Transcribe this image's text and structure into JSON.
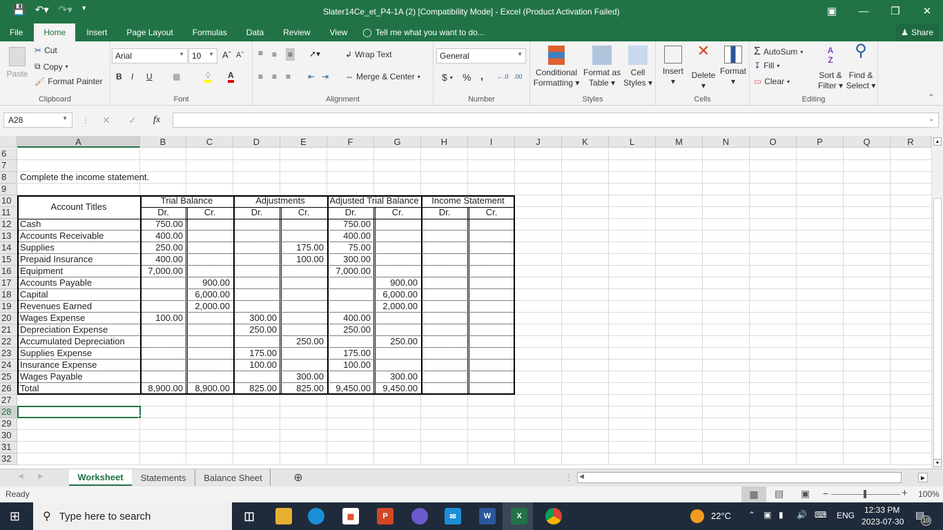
{
  "window": {
    "title": "Slater14Ce_et_P4-1A (2)  [Compatibility Mode] - Excel (Product Activation Failed)",
    "controls": [
      "ribbon-display",
      "minimize",
      "restore",
      "close"
    ]
  },
  "ribbon_tabs": [
    "File",
    "Home",
    "Insert",
    "Page Layout",
    "Formulas",
    "Data",
    "Review",
    "View"
  ],
  "active_tab": "Home",
  "tell_me": "Tell me what you want to do...",
  "share_label": "Share",
  "ribbon": {
    "clipboard": {
      "label": "Clipboard",
      "paste": "Paste",
      "cut": "Cut",
      "copy": "Copy",
      "format_painter": "Format Painter"
    },
    "font": {
      "label": "Font",
      "font_name": "Arial",
      "font_size": "10",
      "bold": "B",
      "italic": "I",
      "underline": "U",
      "fill_color": "#ffff00",
      "font_color": "#e00000"
    },
    "alignment": {
      "label": "Alignment",
      "wrap_text": "Wrap Text",
      "merge_center": "Merge & Center"
    },
    "number": {
      "label": "Number",
      "format": "General",
      "currency": "$",
      "percent": "%",
      "comma": ","
    },
    "styles": {
      "label": "Styles",
      "conditional_1": "Conditional",
      "conditional_2": "Formatting",
      "format_table_1": "Format as",
      "format_table_2": "Table",
      "cell_styles_1": "Cell",
      "cell_styles_2": "Styles"
    },
    "cells": {
      "label": "Cells",
      "insert": "Insert",
      "delete": "Delete",
      "format": "Format"
    },
    "editing": {
      "label": "Editing",
      "autosum": "AutoSum",
      "fill": "Fill",
      "clear": "Clear",
      "sort_1": "Sort &",
      "sort_2": "Filter",
      "find_1": "Find &",
      "find_2": "Select"
    }
  },
  "formula_bar": {
    "name_box": "A28",
    "fx": "fx",
    "value": ""
  },
  "columns": [
    "A",
    "B",
    "C",
    "D",
    "E",
    "F",
    "G",
    "H",
    "I",
    "J",
    "K",
    "L",
    "M",
    "N",
    "O",
    "P",
    "Q",
    "R"
  ],
  "rows": [
    "6",
    "7",
    "8",
    "9",
    "10",
    "11",
    "12",
    "13",
    "14",
    "15",
    "16",
    "17",
    "18",
    "19",
    "20",
    "21",
    "22",
    "23",
    "24",
    "25",
    "26",
    "27",
    "28",
    "29",
    "30",
    "31",
    "32"
  ],
  "instruction": "Complete the income statement.",
  "worksheet": {
    "account_titles_header": "Account Titles",
    "groups": [
      "Trial Balance",
      "Adjustments",
      "Adjusted Trial Balance",
      "Income Statement"
    ],
    "sub": [
      "Dr.",
      "Cr.",
      "Dr.",
      "Cr.",
      "Dr.",
      "Cr.",
      "Dr.",
      "Cr."
    ],
    "rows": [
      {
        "row": "12",
        "account": "Cash",
        "tb_dr": "750.00",
        "tb_cr": "",
        "adj_dr": "",
        "adj_cr": "",
        "atb_dr": "750.00",
        "atb_cr": "",
        "is_dr": "",
        "is_cr": ""
      },
      {
        "row": "13",
        "account": "Accounts Receivable",
        "tb_dr": "400.00",
        "tb_cr": "",
        "adj_dr": "",
        "adj_cr": "",
        "atb_dr": "400.00",
        "atb_cr": "",
        "is_dr": "",
        "is_cr": ""
      },
      {
        "row": "14",
        "account": "Supplies",
        "tb_dr": "250.00",
        "tb_cr": "",
        "adj_dr": "",
        "adj_cr": "175.00",
        "atb_dr": "75.00",
        "atb_cr": "",
        "is_dr": "",
        "is_cr": ""
      },
      {
        "row": "15",
        "account": "Prepaid Insurance",
        "tb_dr": "400.00",
        "tb_cr": "",
        "adj_dr": "",
        "adj_cr": "100.00",
        "atb_dr": "300.00",
        "atb_cr": "",
        "is_dr": "",
        "is_cr": ""
      },
      {
        "row": "16",
        "account": "Equipment",
        "tb_dr": "7,000.00",
        "tb_cr": "",
        "adj_dr": "",
        "adj_cr": "",
        "atb_dr": "7,000.00",
        "atb_cr": "",
        "is_dr": "",
        "is_cr": ""
      },
      {
        "row": "17",
        "account": "Accounts Payable",
        "tb_dr": "",
        "tb_cr": "900.00",
        "adj_dr": "",
        "adj_cr": "",
        "atb_dr": "",
        "atb_cr": "900.00",
        "is_dr": "",
        "is_cr": ""
      },
      {
        "row": "18",
        "account": "Capital",
        "tb_dr": "",
        "tb_cr": "6,000.00",
        "adj_dr": "",
        "adj_cr": "",
        "atb_dr": "",
        "atb_cr": "6,000.00",
        "is_dr": "",
        "is_cr": ""
      },
      {
        "row": "19",
        "account": "Revenues Earned",
        "tb_dr": "",
        "tb_cr": "2,000.00",
        "adj_dr": "",
        "adj_cr": "",
        "atb_dr": "",
        "atb_cr": "2,000.00",
        "is_dr": "",
        "is_cr": ""
      },
      {
        "row": "20",
        "account": "Wages Expense",
        "tb_dr": "100.00",
        "tb_cr": "",
        "adj_dr": "300.00",
        "adj_cr": "",
        "atb_dr": "400.00",
        "atb_cr": "",
        "is_dr": "",
        "is_cr": ""
      },
      {
        "row": "21",
        "account": "Depreciation Expense",
        "tb_dr": "",
        "tb_cr": "",
        "adj_dr": "250.00",
        "adj_cr": "",
        "atb_dr": "250.00",
        "atb_cr": "",
        "is_dr": "",
        "is_cr": ""
      },
      {
        "row": "22",
        "account": "Accumulated Depreciation",
        "tb_dr": "",
        "tb_cr": "",
        "adj_dr": "",
        "adj_cr": "250.00",
        "atb_dr": "",
        "atb_cr": "250.00",
        "is_dr": "",
        "is_cr": ""
      },
      {
        "row": "23",
        "account": "Supplies Expense",
        "tb_dr": "",
        "tb_cr": "",
        "adj_dr": "175.00",
        "adj_cr": "",
        "atb_dr": "175.00",
        "atb_cr": "",
        "is_dr": "",
        "is_cr": ""
      },
      {
        "row": "24",
        "account": "Insurance Expense",
        "tb_dr": "",
        "tb_cr": "",
        "adj_dr": "100.00",
        "adj_cr": "",
        "atb_dr": "100.00",
        "atb_cr": "",
        "is_dr": "",
        "is_cr": ""
      },
      {
        "row": "25",
        "account": "Wages Payable",
        "tb_dr": "",
        "tb_cr": "",
        "adj_dr": "",
        "adj_cr": "300.00",
        "atb_dr": "",
        "atb_cr": "300.00",
        "is_dr": "",
        "is_cr": ""
      },
      {
        "row": "26",
        "account": "Total",
        "tb_dr": "8,900.00",
        "tb_cr": "8,900.00",
        "adj_dr": "825.00",
        "adj_cr": "825.00",
        "atb_dr": "9,450.00",
        "atb_cr": "9,450.00",
        "is_dr": "",
        "is_cr": ""
      }
    ]
  },
  "sheets": [
    "Worksheet",
    "Statements",
    "Balance Sheet"
  ],
  "active_sheet": "Worksheet",
  "status": {
    "ready": "Ready",
    "zoom": "100%"
  },
  "taskbar": {
    "search_placeholder": "Type here to search",
    "apps": [
      "task-view",
      "file-explorer",
      "edge",
      "store",
      "powerpoint",
      "copilot",
      "mail",
      "word",
      "excel",
      "chrome"
    ],
    "weather": "22°C",
    "language": "ENG",
    "time": "12:33 PM",
    "date": "2023-07-30",
    "notifications": "10"
  },
  "colors": {
    "excel_green": "#217346",
    "taskbar": "#1f2b3a"
  }
}
